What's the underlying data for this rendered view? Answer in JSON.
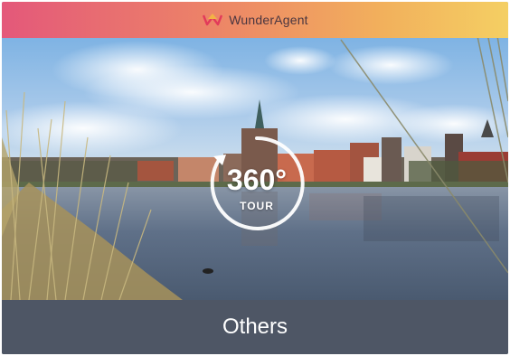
{
  "header": {
    "brand_name": "WunderAgent",
    "logo_icon": "crown-house-icon",
    "gradient_colors": [
      "#e4587a",
      "#ec8268",
      "#f2b05c",
      "#f4cf63"
    ]
  },
  "badge": {
    "number": "360°",
    "label": "TOUR",
    "icon": "tour-360-icon"
  },
  "footer": {
    "title": "Others"
  },
  "colors": {
    "sky": "#7fb3e2",
    "water": "#5b6f86",
    "footer_bg": "#4e5664"
  }
}
